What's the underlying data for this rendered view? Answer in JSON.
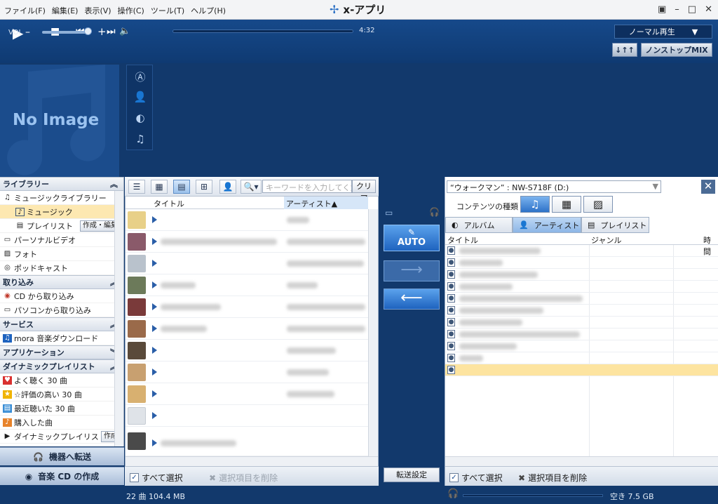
{
  "menu": [
    "ファイル(F)",
    "編集(E)",
    "表示(V)",
    "操作(C)",
    "ツール(T)",
    "ヘルプ(H)"
  ],
  "app_title": "x-アプリ",
  "window_controls": [
    "▣",
    "–",
    "□",
    "✕"
  ],
  "player": {
    "vol_label": "VOL",
    "time": "4:32",
    "play_mode": "ノーマル再生",
    "eq_btn": "↓↑↑",
    "nonstop": "ノンストップMIX",
    "volume_level": 0.85
  },
  "no_image": "No Image",
  "left_nav": {
    "library": "ライブラリー",
    "music_library": "ミュージックライブラリー",
    "music": "ミュージック",
    "playlist": "プレイリスト",
    "playlist_btn": "作成・編集",
    "personal_video": "パーソナルビデオ",
    "photo": "フォト",
    "podcast": "ポッドキャスト",
    "import": "取り込み",
    "cd_import": "CD から取り込み",
    "pc_import": "パソコンから取り込み",
    "service": "サービス",
    "mora": "mora 音楽ダウンロード",
    "application": "アプリケーション",
    "dynamic": "ダイナミックプレイリスト",
    "dyn1": "よく聴く 30 曲",
    "dyn2": "☆評価の高い 30 曲",
    "dyn3": "最近聴いた 30 曲",
    "dyn4": "購入した曲",
    "dyn5": "ダイナミックプレイリスト",
    "dyn5_btn": "作成",
    "to_device": "機器へ転送",
    "make_cd": "音楽 CD の作成"
  },
  "middle": {
    "search_placeholder": "キーワードを入力してくだ",
    "clear": "クリア",
    "col_title": "タイトル",
    "col_artist": "アーティスト▲",
    "select_all": "すべて選択",
    "delete_selected": "選択項目を削除"
  },
  "transfer": {
    "auto": "AUTO",
    "settings": "転送設定"
  },
  "right": {
    "device": "“ウォークマン” : NW-S718F (D:)",
    "content_type": "コンテンツの種類",
    "tab_album": "アルバム",
    "tab_artist": "アーティスト",
    "tab_playlist": "プレイリスト",
    "col_title": "タイトル",
    "col_genre": "ジャンル",
    "col_time": "時間",
    "select_all": "すべて選択",
    "delete_selected": "選択項目を削除"
  },
  "status": {
    "count": "22 曲  104.4 MB",
    "free": "空き 7.5 GB"
  },
  "colors": {
    "accent": "#1e63bf",
    "selected_row": "#fde8b1",
    "background": "#12396c"
  }
}
